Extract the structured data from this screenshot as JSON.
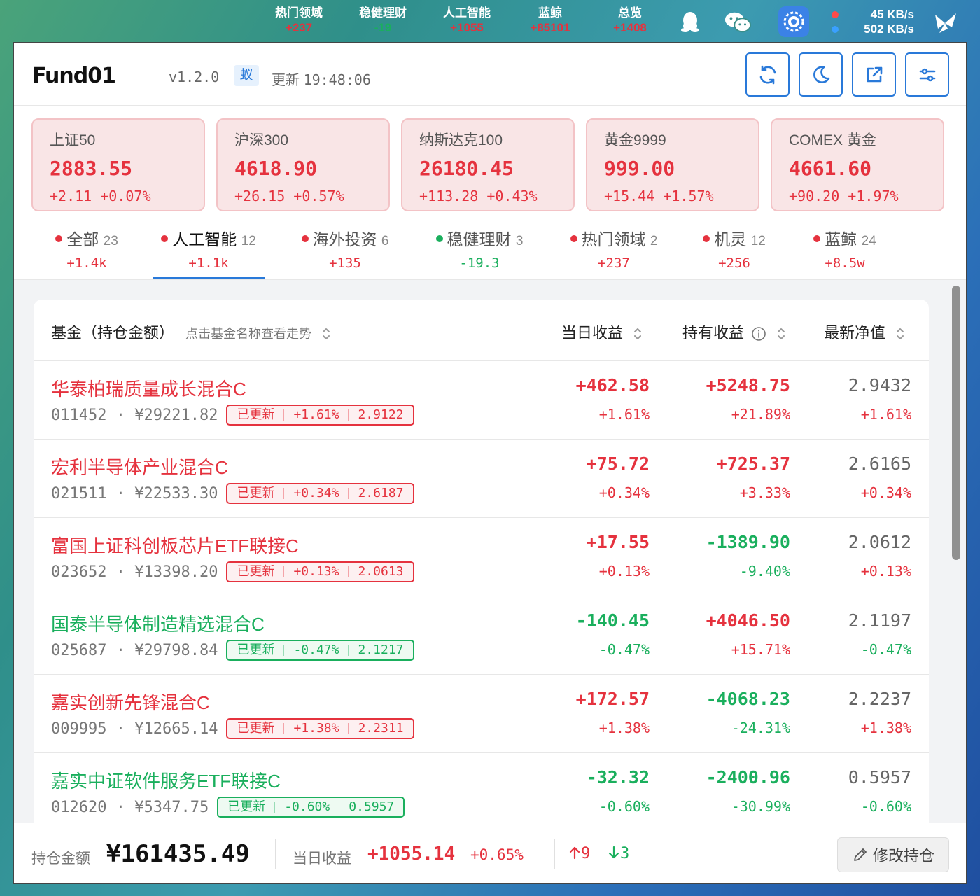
{
  "menubar": {
    "items": [
      {
        "label": "热门领域",
        "value": "+237"
      },
      {
        "label": "稳健理财",
        "value": "-19"
      },
      {
        "label": "人工智能",
        "value": "+1055"
      },
      {
        "label": "蓝鲸",
        "value": "+85101"
      },
      {
        "label": "总览",
        "value": "+1408"
      }
    ],
    "net_up": "45 KB/s",
    "net_down": "502 KB/s"
  },
  "header": {
    "logo": "Fund01",
    "version": "v1.2.0",
    "badge": "蚁",
    "updated_label": "更新",
    "updated_time": "19:48:06",
    "buttons": [
      "refresh-icon",
      "moon-icon",
      "external-link-icon",
      "sliders-icon"
    ]
  },
  "indices": [
    {
      "name": "上证50",
      "price": "2883.55",
      "change": "+2.11 +0.07%"
    },
    {
      "name": "沪深300",
      "price": "4618.90",
      "change": "+26.15 +0.57%"
    },
    {
      "name": "纳斯达克100",
      "price": "26180.45",
      "change": "+113.28 +0.43%"
    },
    {
      "name": "黄金9999",
      "price": "999.00",
      "change": "+15.44 +1.57%"
    },
    {
      "name": "COMEX 黄金",
      "price": "4661.60",
      "change": "+90.20 +1.97%"
    }
  ],
  "tabs": [
    {
      "name": "全部",
      "count": "23",
      "value": "+1.4k",
      "color": "red"
    },
    {
      "name": "人工智能",
      "count": "12",
      "value": "+1.1k",
      "color": "red"
    },
    {
      "name": "海外投资",
      "count": "6",
      "value": "+135",
      "color": "red"
    },
    {
      "name": "稳健理财",
      "count": "3",
      "value": "-19.3",
      "color": "green"
    },
    {
      "name": "热门领域",
      "count": "2",
      "value": "+237",
      "color": "red"
    },
    {
      "name": "机灵",
      "count": "12",
      "value": "+256",
      "color": "red"
    },
    {
      "name": "蓝鲸",
      "count": "24",
      "value": "+8.5w",
      "color": "red"
    }
  ],
  "table": {
    "col_fund": "基金（持仓金额）",
    "col_fund_hint": "点击基金名称查看走势",
    "col_day": "当日收益",
    "col_hold": "持有收益",
    "col_nav": "最新净值",
    "rows": [
      {
        "name": "华泰柏瑞质量成长混合C",
        "code": "011452",
        "amount": "¥29221.82",
        "status": "已更新",
        "est_pct": "+1.61%",
        "est_nav": "2.9122",
        "day": "+462.58",
        "day_pct": "+1.61%",
        "hold": "+5248.75",
        "hold_pct": "+21.89%",
        "nav": "2.9432",
        "nav_pct": "+1.61%",
        "c": "red",
        "hc": "red"
      },
      {
        "name": "宏利半导体产业混合C",
        "code": "021511",
        "amount": "¥22533.30",
        "status": "已更新",
        "est_pct": "+0.34%",
        "est_nav": "2.6187",
        "day": "+75.72",
        "day_pct": "+0.34%",
        "hold": "+725.37",
        "hold_pct": "+3.33%",
        "nav": "2.6165",
        "nav_pct": "+0.34%",
        "c": "red",
        "hc": "red"
      },
      {
        "name": "富国上证科创板芯片ETF联接C",
        "code": "023652",
        "amount": "¥13398.20",
        "status": "已更新",
        "est_pct": "+0.13%",
        "est_nav": "2.0613",
        "day": "+17.55",
        "day_pct": "+0.13%",
        "hold": "-1389.90",
        "hold_pct": "-9.40%",
        "nav": "2.0612",
        "nav_pct": "+0.13%",
        "c": "red",
        "hc": "green"
      },
      {
        "name": "国泰半导体制造精选混合C",
        "code": "025687",
        "amount": "¥29798.84",
        "status": "已更新",
        "est_pct": "-0.47%",
        "est_nav": "2.1217",
        "day": "-140.45",
        "day_pct": "-0.47%",
        "hold": "+4046.50",
        "hold_pct": "+15.71%",
        "nav": "2.1197",
        "nav_pct": "-0.47%",
        "c": "green",
        "hc": "red"
      },
      {
        "name": "嘉实创新先锋混合C",
        "code": "009995",
        "amount": "¥12665.14",
        "status": "已更新",
        "est_pct": "+1.38%",
        "est_nav": "2.2311",
        "day": "+172.57",
        "day_pct": "+1.38%",
        "hold": "-4068.23",
        "hold_pct": "-24.31%",
        "nav": "2.2237",
        "nav_pct": "+1.38%",
        "c": "red",
        "hc": "green"
      },
      {
        "name": "嘉实中证软件服务ETF联接C",
        "code": "012620",
        "amount": "¥5347.75",
        "status": "已更新",
        "est_pct": "-0.60%",
        "est_nav": "0.5957",
        "day": "-32.32",
        "day_pct": "-0.60%",
        "hold": "-2400.96",
        "hold_pct": "-30.99%",
        "nav": "0.5957",
        "nav_pct": "-0.60%",
        "c": "green",
        "hc": "green"
      }
    ]
  },
  "footer": {
    "amount_label": "持仓金额",
    "amount": "¥161435.49",
    "day_label": "当日收益",
    "day": "+1055.14",
    "day_pct": "+0.65%",
    "up_count": "9",
    "down_count": "3",
    "edit_label": "修改持仓"
  },
  "colors": {
    "up": "#e5323e",
    "down": "#1aaf5d",
    "accent": "#2979d9"
  }
}
